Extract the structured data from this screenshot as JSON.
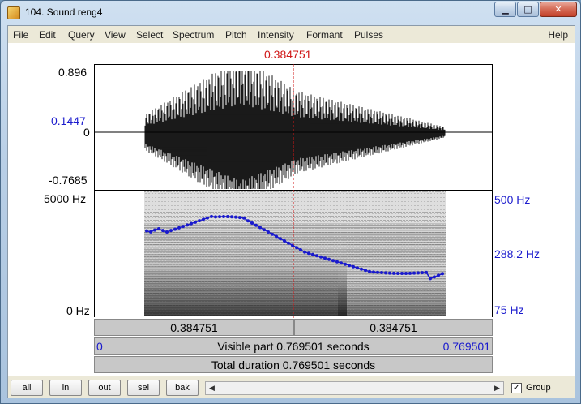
{
  "window": {
    "title": "104. Sound reng4",
    "minimize_glyph": "▁",
    "maximize_glyph": "□",
    "close_glyph": "✕"
  },
  "menu": [
    "File",
    "Edit",
    "Query",
    "View",
    "Select",
    "Spectrum",
    "Pitch",
    "Intensity",
    "Formant",
    "Pulses"
  ],
  "menu_help": "Help",
  "cursor": {
    "time_label": "0.384751"
  },
  "waveform": {
    "y_max": "0.896",
    "y_cursor": "0.1447",
    "y_zero": "0",
    "y_min": "-0.7685"
  },
  "spectrogram": {
    "freq_top": "5000 Hz",
    "freq_bottom": "0 Hz",
    "pitch_top": "500 Hz",
    "pitch_cursor": "288.2 Hz",
    "pitch_bottom": "75 Hz"
  },
  "bars": {
    "left_segment": "0.384751",
    "right_segment": "0.384751",
    "visible_start": "0",
    "visible_label": "Visible part 0.769501 seconds",
    "visible_end": "0.769501",
    "total_label": "Total duration 0.769501 seconds"
  },
  "buttons": {
    "all": "all",
    "in": "in",
    "out": "out",
    "sel": "sel",
    "bak": "bak"
  },
  "group": {
    "label": "Group",
    "checked": true,
    "check_glyph": "✓"
  },
  "scroll_arrows": {
    "left": "◀",
    "right": "▶"
  },
  "colors": {
    "cursor": "#d01818",
    "pitch": "#1a1acd"
  }
}
